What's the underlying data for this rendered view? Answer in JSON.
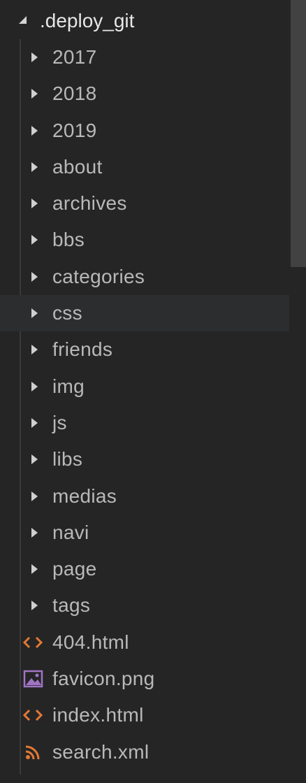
{
  "root": {
    "label": ".deploy_git",
    "expanded": true
  },
  "items": [
    {
      "label": "2017",
      "kind": "folder",
      "icon": "chevron-right-icon"
    },
    {
      "label": "2018",
      "kind": "folder",
      "icon": "chevron-right-icon"
    },
    {
      "label": "2019",
      "kind": "folder",
      "icon": "chevron-right-icon"
    },
    {
      "label": "about",
      "kind": "folder",
      "icon": "chevron-right-icon"
    },
    {
      "label": "archives",
      "kind": "folder",
      "icon": "chevron-right-icon"
    },
    {
      "label": "bbs",
      "kind": "folder",
      "icon": "chevron-right-icon"
    },
    {
      "label": "categories",
      "kind": "folder",
      "icon": "chevron-right-icon"
    },
    {
      "label": "css",
      "kind": "folder",
      "icon": "chevron-right-icon",
      "focused": true
    },
    {
      "label": "friends",
      "kind": "folder",
      "icon": "chevron-right-icon"
    },
    {
      "label": "img",
      "kind": "folder",
      "icon": "chevron-right-icon"
    },
    {
      "label": "js",
      "kind": "folder",
      "icon": "chevron-right-icon"
    },
    {
      "label": "libs",
      "kind": "folder",
      "icon": "chevron-right-icon"
    },
    {
      "label": "medias",
      "kind": "folder",
      "icon": "chevron-right-icon"
    },
    {
      "label": "navi",
      "kind": "folder",
      "icon": "chevron-right-icon"
    },
    {
      "label": "page",
      "kind": "folder",
      "icon": "chevron-right-icon"
    },
    {
      "label": "tags",
      "kind": "folder",
      "icon": "chevron-right-icon"
    },
    {
      "label": "404.html",
      "kind": "file",
      "icon": "html-file-icon"
    },
    {
      "label": "favicon.png",
      "kind": "file",
      "icon": "image-file-icon"
    },
    {
      "label": "index.html",
      "kind": "file",
      "icon": "html-file-icon"
    },
    {
      "label": "search.xml",
      "kind": "file",
      "icon": "rss-file-icon"
    }
  ],
  "colors": {
    "background": "#252526",
    "focused_row": "#2b2d2e",
    "text": "#b9b9b9",
    "html_icon": "#e37933",
    "image_icon": "#a074c4",
    "rss_icon": "#e37933",
    "scroll_thumb": "#424242"
  }
}
